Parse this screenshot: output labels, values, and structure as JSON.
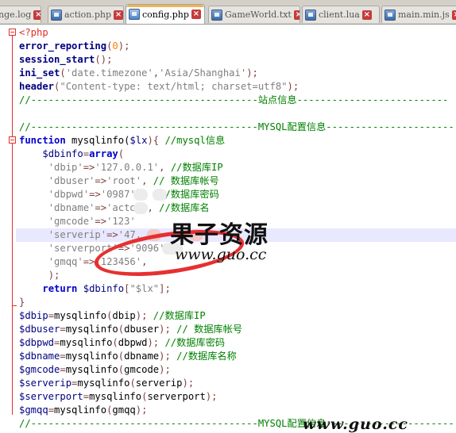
{
  "tabs": [
    {
      "label": "nge.log",
      "active": false,
      "close": "×"
    },
    {
      "label": "action.php",
      "active": false,
      "close": "×"
    },
    {
      "label": "config.php",
      "active": true,
      "close": "×"
    },
    {
      "label": "GameWorld.txt",
      "active": false,
      "close": "×"
    },
    {
      "label": "client.lua",
      "active": false,
      "close": "×"
    },
    {
      "label": "main.min.js",
      "active": false,
      "close": "×"
    }
  ],
  "code": {
    "l1": "<?php",
    "l2_fn": "error_reporting",
    "l2_num": "0",
    "l3_fn": "session_start",
    "l4_fn": "ini_set",
    "l4_s1": "'date.timezone'",
    "l4_s2": "'Asia/Shanghai'",
    "l5_fn": "header",
    "l5_s": "\"Content-type: text/html; charset=utf8\"",
    "l6": "//---------------------------------------站点信息--------------------------",
    "l8": "//---------------------------------------MYSQL配置信息----------------------",
    "l9_kw": "function",
    "l9_name": " mysqlinfo(",
    "l9_var": "$lx",
    "l9_rest": "){ ",
    "l9_cm": "//mysql信息",
    "l10_var": "$dbinfo",
    "l10_kw": "array",
    "l11_key": "'dbip'",
    "l11_val": "'127.0.0.1'",
    "l11_cm": "//数据库IP",
    "l12_key": "'dbuser'",
    "l12_val": "'root'",
    "l12_cm": "// 数据库帐号",
    "l13_key": "'dbpwd'",
    "l13_val": "'0987'",
    "l13_cm": "//数据库密码",
    "l14_key": "'dbname'",
    "l14_val": "'actor'",
    "l14_cm": "//数据库名",
    "l15_key": "'gmcode'",
    "l15_val": "'123'",
    "l16_key": "'serverip'",
    "l16_val": "'47.",
    "l17_key": "'serverport'",
    "l17_val": "'9096'",
    "l18_key": "'gmqq'",
    "l18_val": "'123456'",
    "l19": ");",
    "l20_kw": "return",
    "l20_var": "$dbinfo",
    "l20_s": "\"$lx\"",
    "l21": "}",
    "l22_var": "$dbip",
    "l22_arg": "dbip",
    "l22_cm": "//数据库IP",
    "l23_var": "$dbuser",
    "l23_arg": "dbuser",
    "l23_cm": "// 数据库帐号",
    "l24_var": "$dbpwd",
    "l24_arg": "dbpwd",
    "l24_cm": "//数据库密码",
    "l25_var": "$dbname",
    "l25_arg": "dbname",
    "l25_cm": "//数据库名称",
    "l26_var": "$gmcode",
    "l26_arg": "gmcode",
    "l27_var": "$serverip",
    "l27_arg": "serverip",
    "l28_var": "$serverport",
    "l28_arg": "serverport",
    "l29_var": "$gmqq",
    "l29_arg": "gmqq",
    "l30": "//---------------------------------------MYSQL配置信息----------------------",
    "call_fn": "mysqlinfo"
  },
  "watermark": {
    "title": "果子资源",
    "url": "www.guo.cc",
    "corner": "www.guo.cc",
    "color": "#e63030"
  }
}
